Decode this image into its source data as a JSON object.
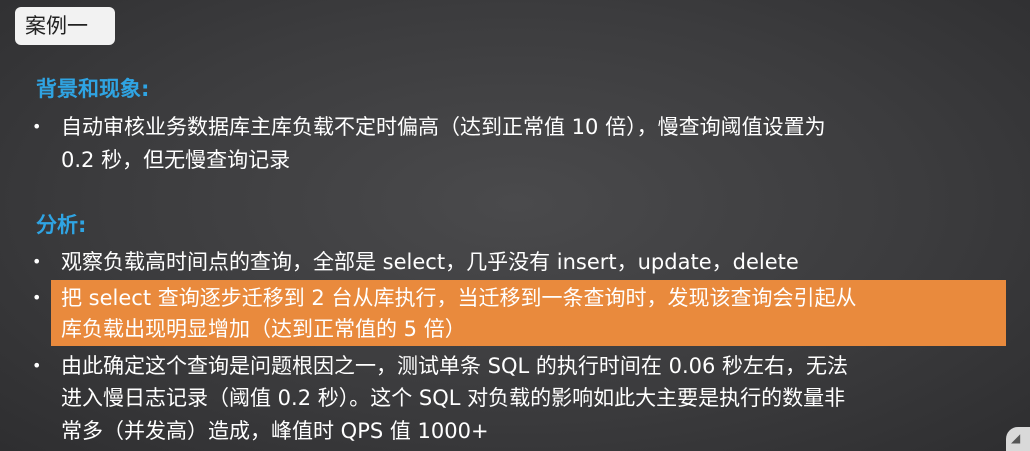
{
  "title_tag": "案例一",
  "background": {
    "heading": "背景和现象:",
    "bullets": [
      {
        "lines": [
          "自动审核业务数据库主库负载不定时偏高（达到正常值 10 倍），慢查询阈值设置为",
          "0.2 秒，但无慢查询记录"
        ]
      }
    ]
  },
  "analysis": {
    "heading": "分析:",
    "bullets": [
      {
        "lines": [
          "观察负载高时间点的查询，全部是 select，几乎没有 insert，update，delete"
        ]
      },
      {
        "highlighted": true,
        "lines": [
          "把 select 查询逐步迁移到 2 台从库执行，当迁移到一条查询时，发现该查询会引起从",
          "库负载出现明显增加（达到正常值的 5 倍）"
        ]
      },
      {
        "lines": [
          "由此确定这个查询是问题根因之一，测试单条 SQL 的执行时间在 0.06 秒左右，无法",
          "进入慢日志记录（阈值 0.2 秒）。这个 SQL 对负载的影响如此大主要是执行的数量非",
          "常多（并发高）造成，峰值时 QPS 值 1000+"
        ]
      }
    ]
  },
  "colors": {
    "heading": "#2fa4e3",
    "highlight": "#e98a3d",
    "text": "#ffffff"
  }
}
